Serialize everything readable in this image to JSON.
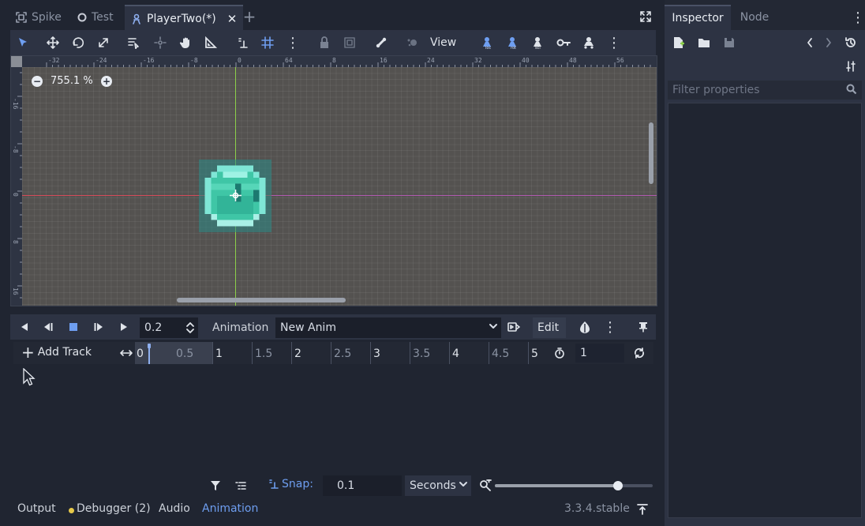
{
  "tabs": [
    {
      "label": "Spike",
      "icon": "select-frame-icon",
      "active": false
    },
    {
      "label": "Test",
      "icon": "circle-node-icon",
      "active": false
    },
    {
      "label": "PlayerTwo(*)",
      "icon": "character-node-icon",
      "active": true
    }
  ],
  "toolbar": {
    "view_label": "View"
  },
  "viewport": {
    "zoom_label": "755.1 %",
    "ruler_top": [
      "-32",
      "-24",
      "-16",
      "-8",
      "0",
      "8",
      "16",
      "24",
      "32",
      "40",
      "48",
      "56",
      "64"
    ],
    "ruler_left": [
      "-16",
      "-8",
      "0",
      "8",
      "16"
    ]
  },
  "animation": {
    "time_value": "0.2",
    "animation_button": "Animation",
    "selected_animation": "New Anim",
    "edit_label": "Edit",
    "add_track_label": "Add Track",
    "timeline_marks": [
      "0",
      "0.5",
      "1",
      "1.5",
      "2",
      "2.5",
      "3",
      "3.5",
      "4",
      "4.5",
      "5"
    ],
    "length_value": "1",
    "snap_label": "Snap:",
    "snap_value": "0.1",
    "time_unit": "Seconds",
    "zoom_fraction": 0.78
  },
  "bottom_panel": {
    "tabs": [
      {
        "label": "Output",
        "active": false
      },
      {
        "label": "Debugger (2)",
        "active": false,
        "dot_color": "#e6c84a"
      },
      {
        "label": "Audio",
        "active": false
      },
      {
        "label": "Animation",
        "active": true
      }
    ],
    "version": "3.3.4.stable"
  },
  "inspector": {
    "tabs": [
      {
        "label": "Inspector",
        "active": true
      },
      {
        "label": "Node",
        "active": false
      }
    ],
    "filter_placeholder": "Filter properties"
  },
  "colors": {
    "accent": "#6e9ef0",
    "axis_x": "#d44a5a",
    "axis_y": "#8cd04a",
    "slime": "#3ec4a8"
  }
}
